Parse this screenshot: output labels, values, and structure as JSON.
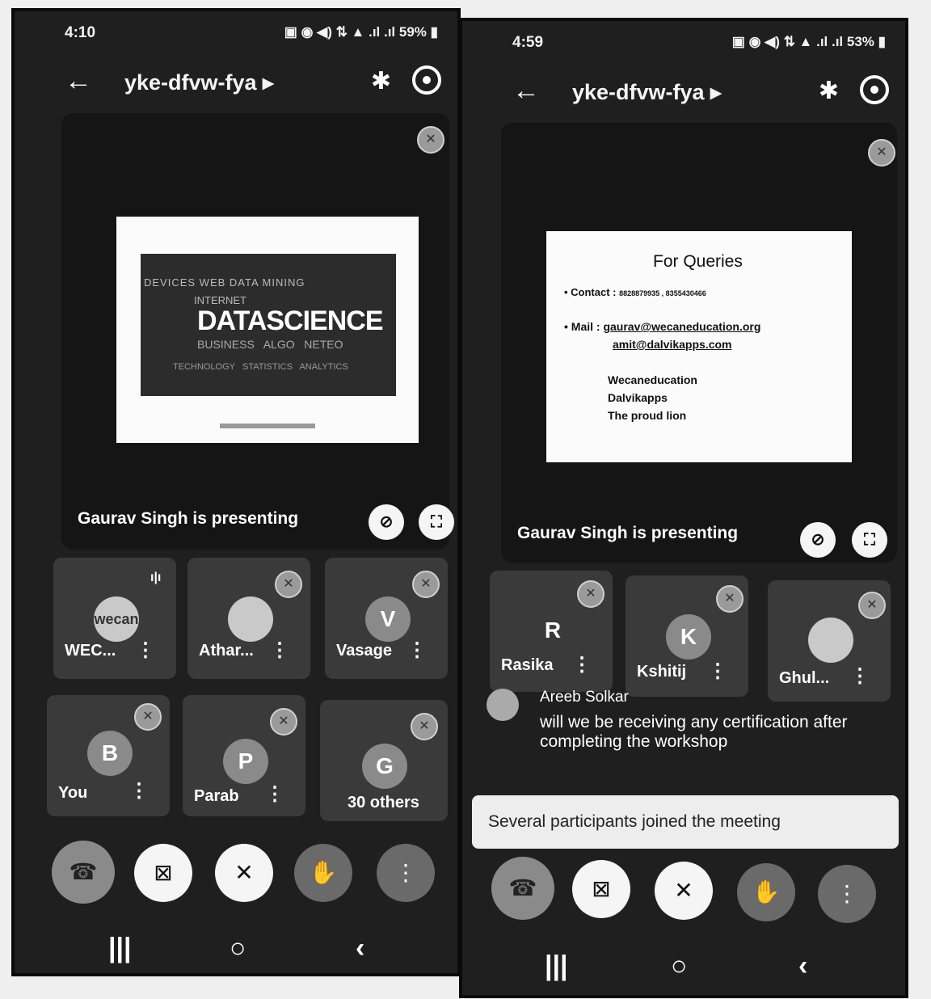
{
  "left": {
    "status": {
      "time": "4:10",
      "battery": "59%"
    },
    "meeting_code": "yke-dfvw-fya ▸",
    "presenting": "Gaurav Singh is presenting",
    "slide": {
      "title": "DATASCIENCE"
    },
    "participants": [
      {
        "initial": "wecan",
        "name": "WEC...",
        "avatar_type": "image"
      },
      {
        "initial": "",
        "name": "Athar...",
        "avatar_type": "image"
      },
      {
        "initial": "V",
        "name": "Vasage",
        "avatar_type": "letter"
      },
      {
        "initial": "B",
        "name": "You",
        "avatar_type": "letter"
      },
      {
        "initial": "P",
        "name": "Parab",
        "avatar_type": "letter"
      },
      {
        "initial": "G",
        "name": "30 others",
        "avatar_type": "letter"
      }
    ]
  },
  "right": {
    "status": {
      "time": "4:59",
      "battery": "53%"
    },
    "meeting_code": "yke-dfvw-fya ▸",
    "presenting": "Gaurav Singh is presenting",
    "slide": {
      "title": "For Queries",
      "contact_label": "• Contact :",
      "contact_value": "8828879935 , 8355430466",
      "mail_label": "• Mail :",
      "mail_1": "gaurav@wecaneducation.org",
      "mail_2": "amit@dalvikapps.com",
      "orgs": [
        "Wecaneducation",
        "Dalvikapps",
        "The proud lion"
      ]
    },
    "participants": [
      {
        "initial": "R",
        "name": "Rasika"
      },
      {
        "initial": "K",
        "name": "Kshitij"
      },
      {
        "initial": "",
        "name": "Ghul..."
      }
    ],
    "chat": {
      "sender": "Areeb Solkar",
      "message": "will we be receiving any certification after completing the workshop"
    },
    "toast": "Several participants joined the meeting"
  },
  "icons": {
    "back": "arrow-left-icon",
    "bluetooth": "bluetooth-icon",
    "camera_switch": "camera-switch-icon",
    "mic_off": "mic-off-icon",
    "fullscreen": "fullscreen-icon",
    "pin_off": "pin-off-icon",
    "end_call": "end-call-icon",
    "video_off": "video-off-icon",
    "raise_hand": "raise-hand-icon",
    "more": "more-vert-icon"
  }
}
